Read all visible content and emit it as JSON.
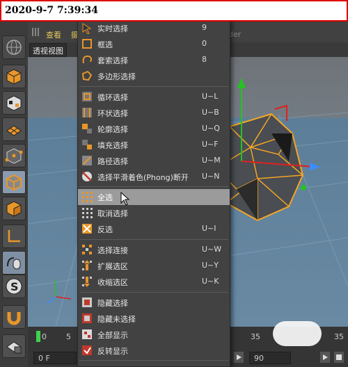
{
  "timestamp": "2020-9-7 7:39:34",
  "viewport": {
    "menu_view": "查看",
    "menu_cam": "摄",
    "title": "透视视图",
    "render_label": "der"
  },
  "timeline": {
    "tick_0": "0",
    "tick_5": "5",
    "tick_35": "35",
    "tick_35b": "35",
    "frame_field": "0 F",
    "end_field": "90"
  },
  "menu": {
    "items": [
      {
        "label": "实时选择",
        "shortcut": "9",
        "icon": "live-selection-icon"
      },
      {
        "label": "框选",
        "shortcut": "0",
        "icon": "rectangle-selection-icon"
      },
      {
        "label": "套索选择",
        "shortcut": "8",
        "icon": "lasso-selection-icon"
      },
      {
        "label": "多边形选择",
        "shortcut": "",
        "icon": "polygon-selection-icon"
      },
      {
        "label": "循环选择",
        "shortcut": "U~L",
        "icon": "loop-selection-icon"
      },
      {
        "label": "环状选择",
        "shortcut": "U~B",
        "icon": "ring-selection-icon"
      },
      {
        "label": "轮廓选择",
        "shortcut": "U~Q",
        "icon": "outline-selection-icon"
      },
      {
        "label": "填充选择",
        "shortcut": "U~F",
        "icon": "fill-selection-icon"
      },
      {
        "label": "路径选择",
        "shortcut": "U~M",
        "icon": "path-selection-icon"
      },
      {
        "label": "选择平滑着色(Phong)断开",
        "shortcut": "U~N",
        "icon": "phong-break-icon"
      },
      {
        "label": "全选",
        "shortcut": "",
        "icon": "select-all-icon"
      },
      {
        "label": "取消选择",
        "shortcut": "",
        "icon": "deselect-icon"
      },
      {
        "label": "反选",
        "shortcut": "U~I",
        "icon": "invert-selection-icon"
      },
      {
        "label": "选择连接",
        "shortcut": "U~W",
        "icon": "select-connected-icon"
      },
      {
        "label": "扩展选区",
        "shortcut": "U~Y",
        "icon": "grow-selection-icon"
      },
      {
        "label": "收缩选区",
        "shortcut": "U~K",
        "icon": "shrink-selection-icon"
      },
      {
        "label": "隐藏选择",
        "shortcut": "",
        "icon": "hide-selected-icon"
      },
      {
        "label": "隐藏未选择",
        "shortcut": "",
        "icon": "hide-unselected-icon"
      },
      {
        "label": "全部显示",
        "shortcut": "",
        "icon": "unhide-all-icon"
      },
      {
        "label": "反转显示",
        "shortcut": "",
        "icon": "invert-visibility-icon"
      }
    ]
  },
  "colors": {
    "accent_orange": "#f5a623",
    "highlight": "#9b9b9b",
    "axis_green": "#22c322",
    "axis_red": "#e02020",
    "axis_blue": "#3c8cff"
  }
}
